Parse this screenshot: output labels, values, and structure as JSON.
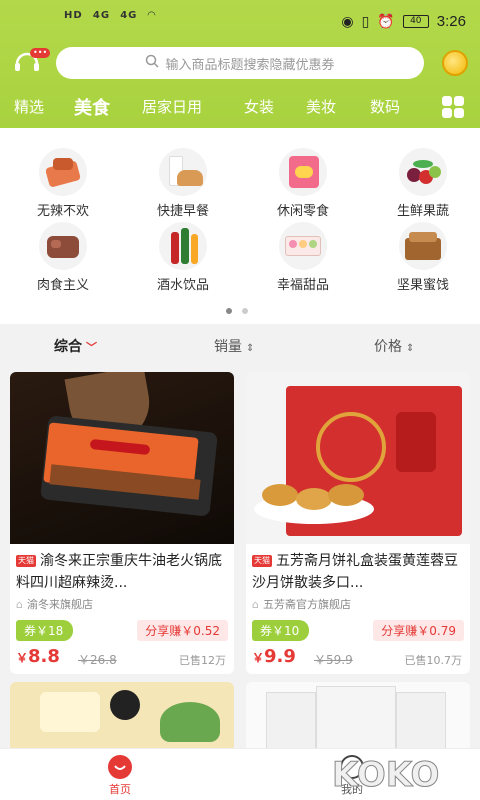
{
  "status_bar": {
    "left": [
      "HD",
      "4G",
      "4G",
      "wifi"
    ],
    "battery": "40",
    "time": "3:26"
  },
  "header": {
    "search_placeholder": "输入商品标题搜索隐藏优惠券",
    "badge": "•••"
  },
  "tabs": [
    {
      "label": "精选",
      "active": false
    },
    {
      "label": "美食",
      "active": true
    },
    {
      "label": "居家日用",
      "active": false
    },
    {
      "label": "女装",
      "active": false
    },
    {
      "label": "美妆",
      "active": false
    },
    {
      "label": "数码",
      "active": false
    }
  ],
  "categories": [
    {
      "label": "无辣不欢",
      "icon": "spicy-meat-icon"
    },
    {
      "label": "快捷早餐",
      "icon": "bread-milk-icon"
    },
    {
      "label": "休闲零食",
      "icon": "snack-bag-icon"
    },
    {
      "label": "生鲜果蔬",
      "icon": "fruit-icon"
    },
    {
      "label": "肉食主义",
      "icon": "meat-icon"
    },
    {
      "label": "酒水饮品",
      "icon": "bottles-icon"
    },
    {
      "label": "幸福甜品",
      "icon": "macaron-icon"
    },
    {
      "label": "坚果蜜饯",
      "icon": "nuts-icon"
    }
  ],
  "sort": {
    "items": [
      "综合",
      "销量",
      "价格"
    ]
  },
  "products": [
    {
      "title": "渝冬来正宗重庆牛油老火锅底料四川超麻辣烫...",
      "mall_tag": "天猫",
      "shop": "渝冬来旗舰店",
      "coupon": "券￥18",
      "share": "分享赚￥0.52",
      "price_symbol": "￥",
      "price": "8.8",
      "original": "￥26.8",
      "sold": "已售12万"
    },
    {
      "title": "五芳斋月饼礼盒装蛋黄莲蓉豆沙月饼散装多口...",
      "mall_tag": "天猫",
      "shop": "五芳斋官方旗舰店",
      "coupon": "券￥10",
      "share": "分享赚￥0.79",
      "price_symbol": "￥",
      "price": "9.9",
      "original": "￥59.9",
      "sold": "已售10.7万"
    }
  ],
  "bottom_nav": [
    {
      "label": "首页",
      "active": true
    },
    {
      "label": "我的",
      "active": false
    }
  ],
  "colors": {
    "brand_green": "#a9d23f",
    "accent_red": "#e53935"
  }
}
